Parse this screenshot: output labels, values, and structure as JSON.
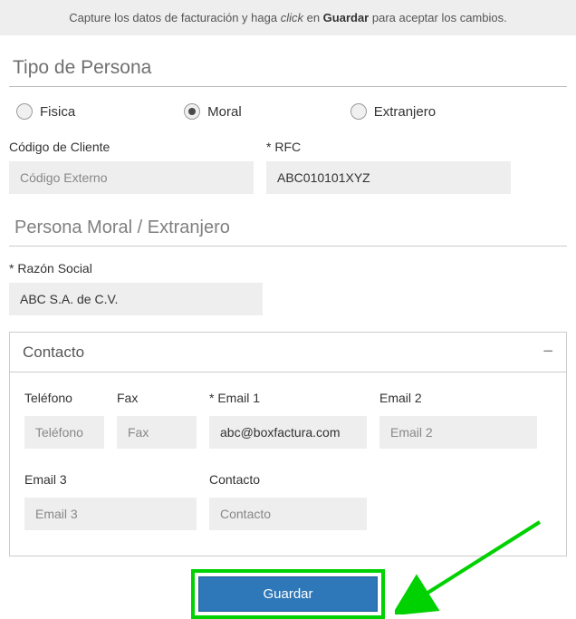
{
  "instruction": {
    "pre": "Capture los datos de facturación y haga ",
    "click": "click",
    "mid": " en ",
    "save": "Guardar",
    "post": " para aceptar los cambios."
  },
  "personType": {
    "title": "Tipo de Persona",
    "options": {
      "fisica": "Fisica",
      "moral": "Moral",
      "extranjero": "Extranjero"
    }
  },
  "fields": {
    "codigo": {
      "label": "Código de Cliente",
      "placeholder": "Código Externo",
      "value": ""
    },
    "rfc": {
      "label": "* RFC",
      "value": "ABC010101XYZ"
    }
  },
  "moralSection": {
    "title": "Persona Moral / Extranjero",
    "razon": {
      "label": "* Razón Social",
      "value": "ABC S.A. de C.V."
    }
  },
  "contact": {
    "title": "Contacto",
    "toggle": "−",
    "telefono": {
      "label": "Teléfono",
      "placeholder": "Teléfono",
      "value": ""
    },
    "fax": {
      "label": "Fax",
      "placeholder": "Fax",
      "value": ""
    },
    "email1": {
      "label": "* Email 1",
      "value": "abc@boxfactura.com"
    },
    "email2": {
      "label": "Email 2",
      "placeholder": "Email 2",
      "value": ""
    },
    "email3": {
      "label": "Email 3",
      "placeholder": "Email 3",
      "value": ""
    },
    "contacto": {
      "label": "Contacto",
      "placeholder": "Contacto",
      "value": ""
    }
  },
  "saveButton": "Guardar"
}
